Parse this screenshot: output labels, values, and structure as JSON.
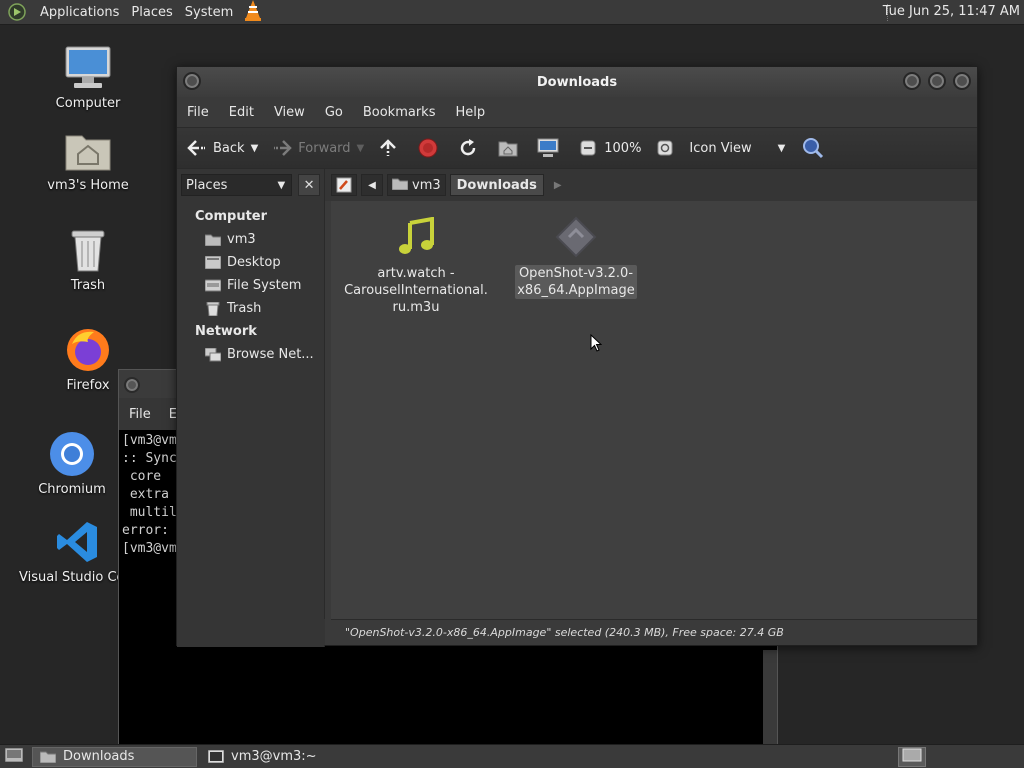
{
  "top_panel": {
    "menus": [
      "Applications",
      "Places",
      "System"
    ],
    "clock": "Tue Jun 25, 11:47 AM",
    "icons": [
      "mate-menu-icon",
      "vlc-icon"
    ]
  },
  "desktop": {
    "icons": [
      {
        "label": "Computer",
        "icon": "computer-icon"
      },
      {
        "label": "vm3's Home",
        "icon": "home-folder-icon"
      },
      {
        "label": "Trash",
        "icon": "trash-icon"
      },
      {
        "label": "Firefox",
        "icon": "firefox-icon"
      },
      {
        "label": "Chromium",
        "icon": "chromium-icon"
      },
      {
        "label": "Visual Studio Code",
        "icon": "vscode-icon"
      }
    ]
  },
  "terminal": {
    "menu": [
      "File",
      "E"
    ],
    "lines": [
      "[vm3@vm",
      ":: Sync",
      " core",
      " extra",
      " multil",
      "error:",
      "[vm3@vm"
    ]
  },
  "file_manager": {
    "title": "Downloads",
    "menu": [
      "File",
      "Edit",
      "View",
      "Go",
      "Bookmarks",
      "Help"
    ],
    "toolbar": {
      "back": "Back",
      "forward": "Forward",
      "zoom": "100%",
      "view_mode": "Icon View"
    },
    "sidebar": {
      "selector": "Places",
      "close_symbol": "✕",
      "groups": [
        {
          "name": "Computer",
          "items": [
            "vm3",
            "Desktop",
            "File System",
            "Trash"
          ]
        },
        {
          "name": "Network",
          "items": [
            "Browse Net..."
          ]
        }
      ]
    },
    "location": {
      "crumbs": [
        "vm3",
        "Downloads"
      ],
      "active": "Downloads"
    },
    "files": [
      {
        "name_lines": [
          "artv.watch -",
          "CarouselInternational.",
          "ru.m3u"
        ],
        "icon": "music-file-icon",
        "selected": false
      },
      {
        "name_lines": [
          "OpenShot-v3.2.0-",
          "x86_64.AppImage"
        ],
        "icon": "appimage-icon",
        "selected": true
      }
    ],
    "status": "\"OpenShot-v3.2.0-x86_64.AppImage\" selected (240.3 MB), Free space: 27.4 GB"
  },
  "taskbar": {
    "tasks": [
      {
        "label": "Downloads",
        "active": true
      },
      {
        "label": "vm3@vm3:~",
        "active": false
      }
    ]
  }
}
